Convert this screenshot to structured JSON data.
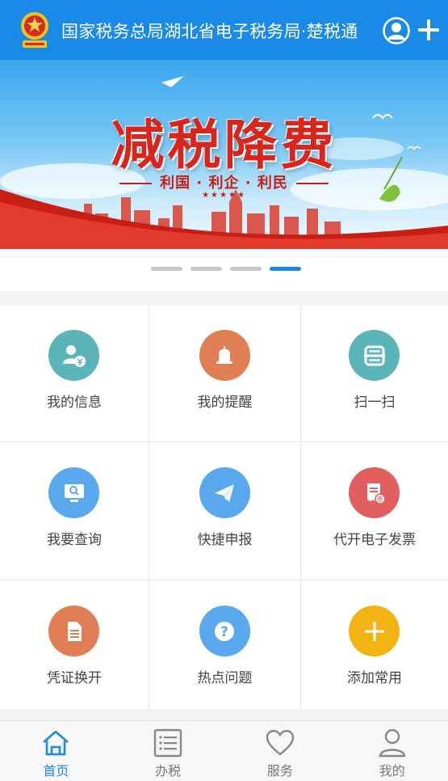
{
  "header": {
    "title": "国家税务总局湖北省电子税务局·楚税通",
    "bg_color": "#1a8ae8",
    "icons": [
      "tax-emblem-icon",
      "user-circle-icon",
      "plus-icon"
    ]
  },
  "banner": {
    "headline": "减税降费",
    "slogan": "利国 · 利企 · 利民",
    "stars": "★★★★★",
    "slide_count": 4,
    "active_slide": 4
  },
  "grid": {
    "items": [
      {
        "label": "我的信息",
        "icon": "user-info-icon",
        "color": "#5bb4b7"
      },
      {
        "label": "我的提醒",
        "icon": "bell-icon",
        "color": "#e07f55"
      },
      {
        "label": "扫一扫",
        "icon": "scan-icon",
        "color": "#5bb4b7"
      },
      {
        "label": "我要查询",
        "icon": "monitor-search-icon",
        "color": "#5aa9ee"
      },
      {
        "label": "快捷申报",
        "icon": "paper-plane-icon",
        "color": "#5aa9ee"
      },
      {
        "label": "代开电子发票",
        "icon": "invoice-icon",
        "color": "#e25f5f"
      },
      {
        "label": "凭证换开",
        "icon": "document-icon",
        "color": "#e07f55"
      },
      {
        "label": "热点问题",
        "icon": "question-icon",
        "color": "#5aa9ee"
      },
      {
        "label": "添加常用",
        "icon": "plus-icon",
        "color": "#f3b312"
      }
    ]
  },
  "tabbar": {
    "tabs": [
      {
        "label": "首页",
        "icon": "home-icon",
        "active": true
      },
      {
        "label": "办税",
        "icon": "list-icon",
        "active": false
      },
      {
        "label": "服务",
        "icon": "heart-icon",
        "active": false
      },
      {
        "label": "我的",
        "icon": "person-icon",
        "active": false
      }
    ],
    "active_color": "#1a8ae8"
  }
}
